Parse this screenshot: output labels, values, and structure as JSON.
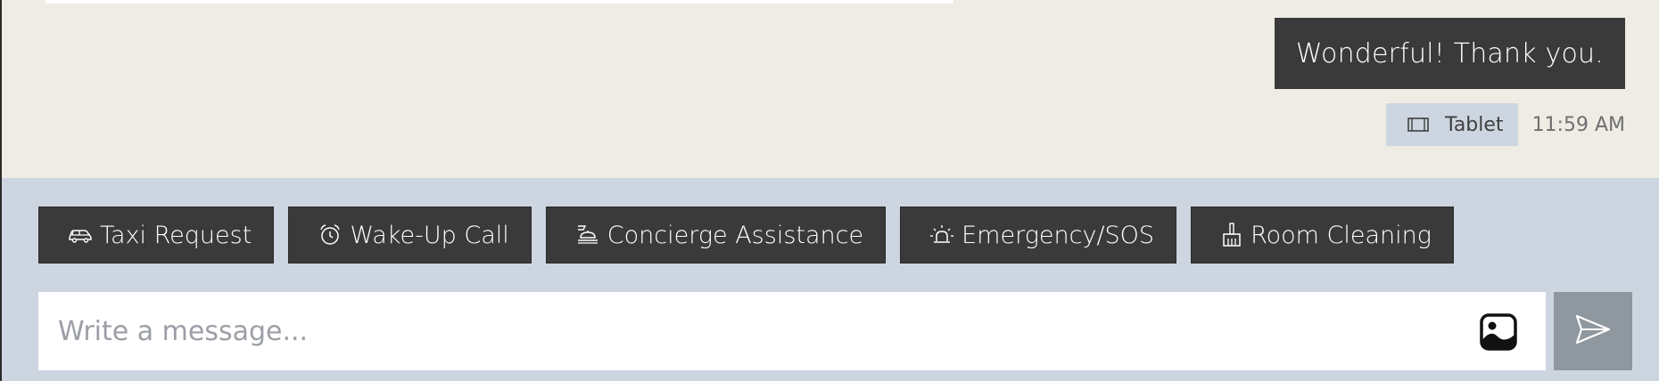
{
  "messages": {
    "last": {
      "text": "Wonderful! Thank you.",
      "device": "Tablet",
      "device_icon": "tablet-icon",
      "time": "11:59 AM"
    }
  },
  "quick_actions": [
    {
      "label": "Taxi Request",
      "icon": "taxi-icon"
    },
    {
      "label": "Wake-Up Call",
      "icon": "alarm-clock-icon"
    },
    {
      "label": "Concierge Assistance",
      "icon": "concierge-icon"
    },
    {
      "label": "Emergency/SOS",
      "icon": "siren-icon"
    },
    {
      "label": "Room Cleaning",
      "icon": "broom-icon"
    }
  ],
  "composer": {
    "placeholder": "Write a message...",
    "value": "",
    "attach_icon": "image-icon",
    "send_icon": "send-icon"
  },
  "colors": {
    "chat_background": "#efece5",
    "composer_background": "#cdd6e0",
    "bubble": "#3a3a3a",
    "send_button": "#8f979f"
  }
}
